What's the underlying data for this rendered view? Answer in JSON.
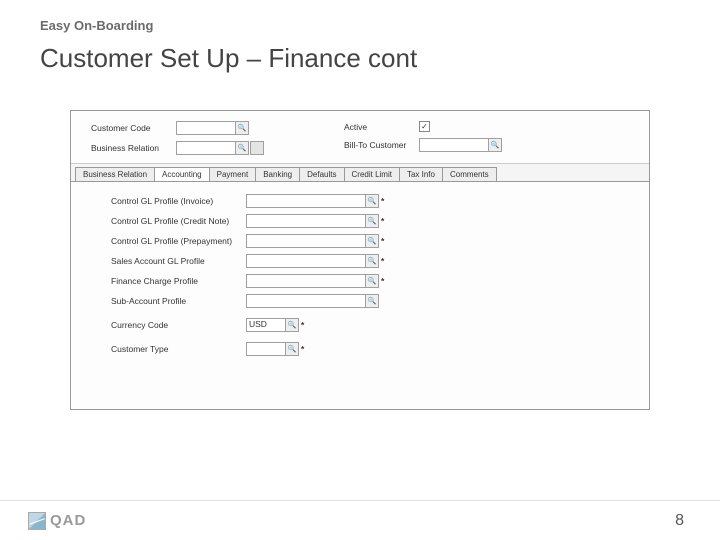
{
  "slide": {
    "breadcrumb": "Easy On-Boarding",
    "title": "Customer Set Up – Finance cont"
  },
  "top": {
    "customer_code_label": "Customer Code",
    "customer_code_value": "",
    "business_relation_label": "Business Relation",
    "business_relation_value": "",
    "active_label": "Active",
    "active_checked": "✓",
    "bill_to_label": "Bill-To Customer",
    "bill_to_value": ""
  },
  "tabs": [
    "Business Relation",
    "Accounting",
    "Payment",
    "Banking",
    "Defaults",
    "Credit Limit",
    "Tax Info",
    "Comments"
  ],
  "acc": {
    "ctrl_invoice_label": "Control GL Profile (Invoice)",
    "ctrl_invoice_value": "",
    "ctrl_cn_label": "Control GL Profile (Credit Note)",
    "ctrl_cn_value": "",
    "ctrl_prepay_label": "Control GL Profile (Prepayment)",
    "ctrl_prepay_value": "",
    "sales_gl_label": "Sales Account GL Profile",
    "sales_gl_value": "",
    "fin_charge_label": "Finance Charge Profile",
    "fin_charge_value": "",
    "sub_acct_label": "Sub-Account Profile",
    "sub_acct_value": "",
    "currency_label": "Currency Code",
    "currency_value": "USD",
    "cust_type_label": "Customer Type",
    "cust_type_value": ""
  },
  "footer": {
    "brand": "QAD",
    "page": "8"
  },
  "req_mark": "*"
}
